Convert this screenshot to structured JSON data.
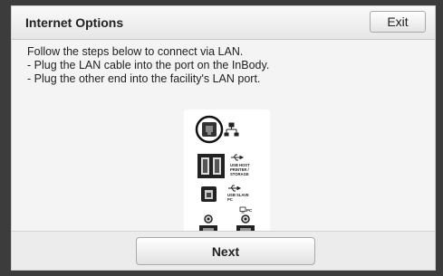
{
  "header": {
    "title": "Internet Options",
    "exit_label": "Exit"
  },
  "instructions": [
    "Follow the steps below to connect via LAN.",
    "- Plug the LAN cable into the port on the InBody.",
    "- Plug the other end into the facility's LAN port."
  ],
  "port_panel": {
    "usb_host_label_1": "USB HOST",
    "usb_host_label_2": "PRINTER /",
    "usb_host_label_3": "STORAGE",
    "usb_slave_label_1": "USB SLAVE",
    "usb_slave_label_2": "PC",
    "pc_label": "PC"
  },
  "footer": {
    "next_label": "Next"
  }
}
